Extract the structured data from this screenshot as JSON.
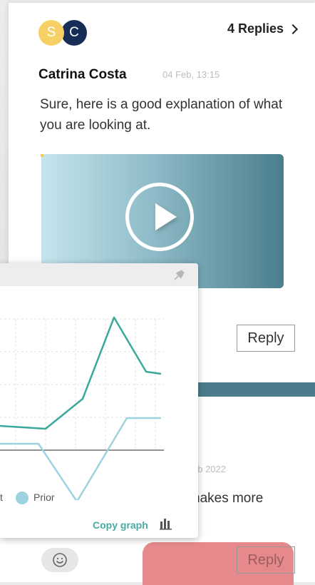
{
  "thread": {
    "avatars": [
      {
        "initial": "S",
        "color": "#f6cf65"
      },
      {
        "initial": "C",
        "color": "#172d55"
      }
    ],
    "replies_label": "4 Replies"
  },
  "comment": {
    "author": "Catrina Costa",
    "timestamp": "04 Feb, 13:15",
    "message": "Sure, here is a good explanation of what you are looking at.",
    "reply_label": "Reply"
  },
  "second_comment": {
    "date_partial": "eb 2022",
    "message_partial": "nakes more",
    "reply_label": "Reply"
  },
  "graph_popup": {
    "legend_partial": "t",
    "legend_prior": "Prior",
    "copy_label": "Copy graph",
    "icons": [
      "pin-icon",
      "bar-chart-icon"
    ]
  },
  "colors": {
    "accent_teal": "#4aa9a4",
    "series_current": "#3aa99b",
    "series_prior": "#9dd2e1",
    "band": "#4a7c8c",
    "highlight": "#e6898c"
  }
}
